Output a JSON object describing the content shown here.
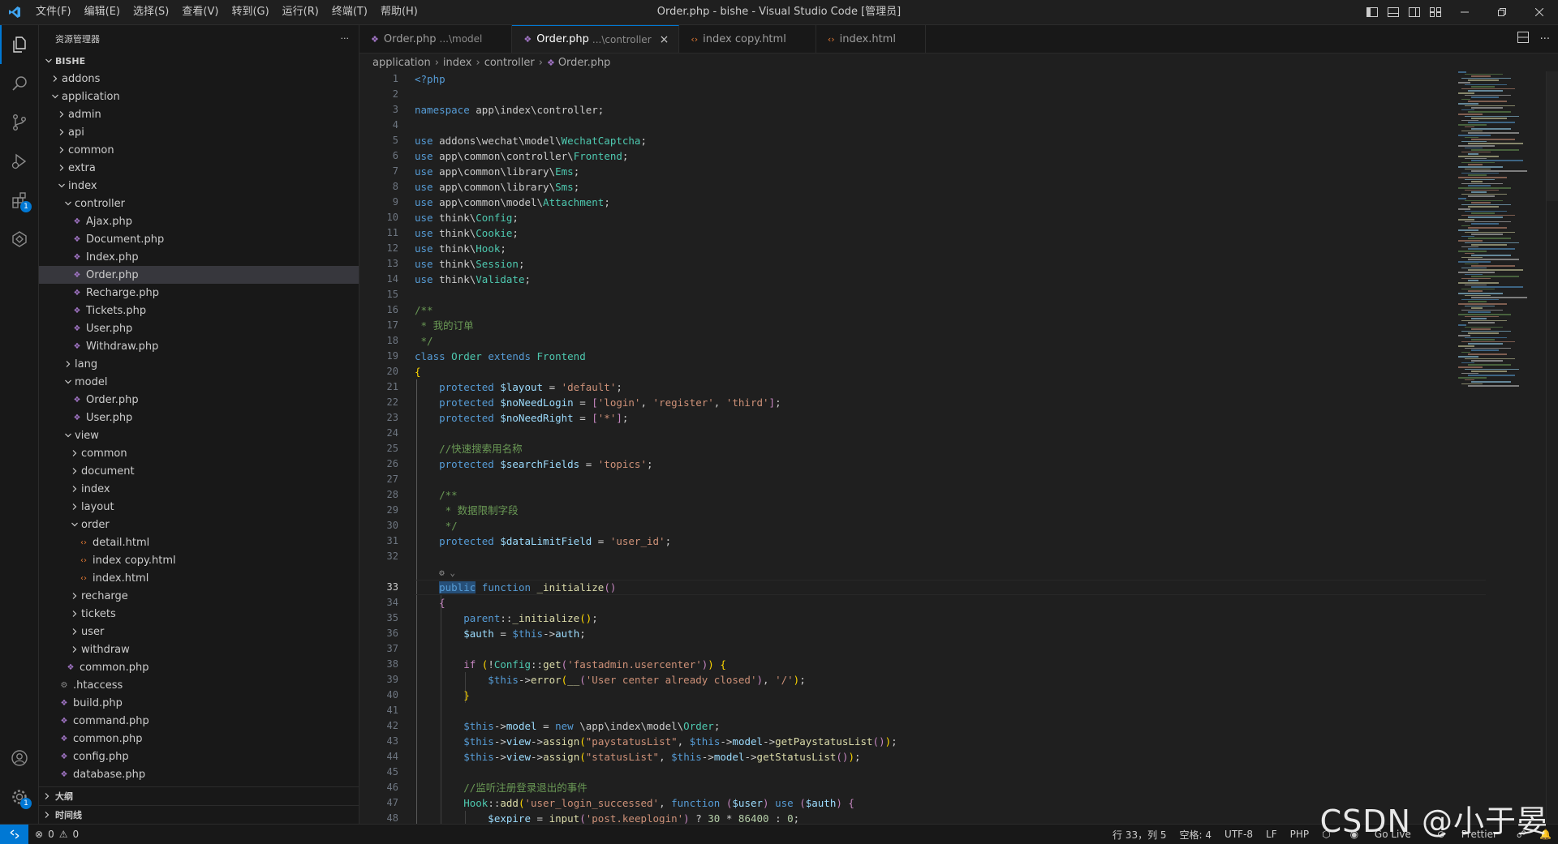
{
  "titlebar": {
    "menu": [
      "文件(F)",
      "编辑(E)",
      "选择(S)",
      "查看(V)",
      "转到(G)",
      "运行(R)",
      "终端(T)",
      "帮助(H)"
    ],
    "title": "Order.php - bishe - Visual Studio Code [管理员]"
  },
  "activity_badges": {
    "extensions": "1",
    "settings": "1"
  },
  "sidebar": {
    "title": "资源管理器",
    "more": "···",
    "bottom_sections": [
      "大纲",
      "时间线"
    ]
  },
  "tree": [
    {
      "label": "BISHE",
      "depth": 0,
      "kind": "root",
      "chev": "down"
    },
    {
      "label": "addons",
      "depth": 1,
      "kind": "folder",
      "chev": "right"
    },
    {
      "label": "application",
      "depth": 1,
      "kind": "folder",
      "chev": "down"
    },
    {
      "label": "admin",
      "depth": 2,
      "kind": "folder",
      "chev": "right"
    },
    {
      "label": "api",
      "depth": 2,
      "kind": "folder",
      "chev": "right"
    },
    {
      "label": "common",
      "depth": 2,
      "kind": "folder",
      "chev": "right"
    },
    {
      "label": "extra",
      "depth": 2,
      "kind": "folder",
      "chev": "right"
    },
    {
      "label": "index",
      "depth": 2,
      "kind": "folder",
      "chev": "down"
    },
    {
      "label": "controller",
      "depth": 3,
      "kind": "folder",
      "chev": "down"
    },
    {
      "label": "Ajax.php",
      "depth": 4,
      "kind": "php"
    },
    {
      "label": "Document.php",
      "depth": 4,
      "kind": "php"
    },
    {
      "label": "Index.php",
      "depth": 4,
      "kind": "php"
    },
    {
      "label": "Order.php",
      "depth": 4,
      "kind": "php",
      "selected": true
    },
    {
      "label": "Recharge.php",
      "depth": 4,
      "kind": "php"
    },
    {
      "label": "Tickets.php",
      "depth": 4,
      "kind": "php"
    },
    {
      "label": "User.php",
      "depth": 4,
      "kind": "php"
    },
    {
      "label": "Withdraw.php",
      "depth": 4,
      "kind": "php"
    },
    {
      "label": "lang",
      "depth": 3,
      "kind": "folder",
      "chev": "right"
    },
    {
      "label": "model",
      "depth": 3,
      "kind": "folder",
      "chev": "down"
    },
    {
      "label": "Order.php",
      "depth": 4,
      "kind": "php"
    },
    {
      "label": "User.php",
      "depth": 4,
      "kind": "php"
    },
    {
      "label": "view",
      "depth": 3,
      "kind": "folder",
      "chev": "down"
    },
    {
      "label": "common",
      "depth": 4,
      "kind": "folder",
      "chev": "right"
    },
    {
      "label": "document",
      "depth": 4,
      "kind": "folder",
      "chev": "right"
    },
    {
      "label": "index",
      "depth": 4,
      "kind": "folder",
      "chev": "right"
    },
    {
      "label": "layout",
      "depth": 4,
      "kind": "folder",
      "chev": "right"
    },
    {
      "label": "order",
      "depth": 4,
      "kind": "folder",
      "chev": "down"
    },
    {
      "label": "detail.html",
      "depth": 5,
      "kind": "html"
    },
    {
      "label": "index copy.html",
      "depth": 5,
      "kind": "html"
    },
    {
      "label": "index.html",
      "depth": 5,
      "kind": "html"
    },
    {
      "label": "recharge",
      "depth": 4,
      "kind": "folder",
      "chev": "right"
    },
    {
      "label": "tickets",
      "depth": 4,
      "kind": "folder",
      "chev": "right"
    },
    {
      "label": "user",
      "depth": 4,
      "kind": "folder",
      "chev": "right"
    },
    {
      "label": "withdraw",
      "depth": 4,
      "kind": "folder",
      "chev": "right"
    },
    {
      "label": "common.php",
      "depth": 3,
      "kind": "php"
    },
    {
      "label": ".htaccess",
      "depth": 2,
      "kind": "gear"
    },
    {
      "label": "build.php",
      "depth": 2,
      "kind": "php"
    },
    {
      "label": "command.php",
      "depth": 2,
      "kind": "php"
    },
    {
      "label": "common.php",
      "depth": 2,
      "kind": "php"
    },
    {
      "label": "config.php",
      "depth": 2,
      "kind": "php"
    },
    {
      "label": "database.php",
      "depth": 2,
      "kind": "php"
    }
  ],
  "tabs": [
    {
      "name": "Order.php",
      "desc": "...\\model",
      "kind": "php",
      "active": false
    },
    {
      "name": "Order.php",
      "desc": "...\\controller",
      "kind": "php",
      "active": true,
      "close": "×"
    },
    {
      "name": "index copy.html",
      "desc": "",
      "kind": "html",
      "active": false
    },
    {
      "name": "index.html",
      "desc": "",
      "kind": "html",
      "active": false
    }
  ],
  "breadcrumb": [
    "application",
    "index",
    "controller",
    "Order.php"
  ],
  "editor": {
    "current_line": 33,
    "line_numbers": [
      1,
      2,
      3,
      4,
      5,
      6,
      7,
      8,
      9,
      10,
      11,
      12,
      13,
      14,
      15,
      16,
      17,
      18,
      19,
      20,
      21,
      22,
      23,
      24,
      25,
      26,
      27,
      28,
      29,
      30,
      31,
      32,
      "",
      33,
      34,
      35,
      36,
      37,
      38,
      39,
      40,
      41,
      42,
      43,
      44,
      45,
      46,
      47,
      48
    ],
    "lines": [
      [
        [
          "<?php",
          "p"
        ]
      ],
      [],
      [
        [
          "namespace ",
          "k"
        ],
        [
          "app\\index\\controller",
          ""
        ],
        [
          ";",
          ""
        ]
      ],
      [],
      [
        [
          "use ",
          "k"
        ],
        [
          "addons\\wechat\\model\\",
          ""
        ],
        [
          "WechatCaptcha",
          "t"
        ],
        [
          ";",
          ""
        ]
      ],
      [
        [
          "use ",
          "k"
        ],
        [
          "app\\common\\controller\\",
          ""
        ],
        [
          "Frontend",
          "t"
        ],
        [
          ";",
          ""
        ]
      ],
      [
        [
          "use ",
          "k"
        ],
        [
          "app\\common\\library\\",
          ""
        ],
        [
          "Ems",
          "t"
        ],
        [
          ";",
          ""
        ]
      ],
      [
        [
          "use ",
          "k"
        ],
        [
          "app\\common\\library\\",
          ""
        ],
        [
          "Sms",
          "t"
        ],
        [
          ";",
          ""
        ]
      ],
      [
        [
          "use ",
          "k"
        ],
        [
          "app\\common\\model\\",
          ""
        ],
        [
          "Attachment",
          "t"
        ],
        [
          ";",
          ""
        ]
      ],
      [
        [
          "use ",
          "k"
        ],
        [
          "think\\",
          ""
        ],
        [
          "Config",
          "t"
        ],
        [
          ";",
          ""
        ]
      ],
      [
        [
          "use ",
          "k"
        ],
        [
          "think\\",
          ""
        ],
        [
          "Cookie",
          "t"
        ],
        [
          ";",
          ""
        ]
      ],
      [
        [
          "use ",
          "k"
        ],
        [
          "think\\",
          ""
        ],
        [
          "Hook",
          "t"
        ],
        [
          ";",
          ""
        ]
      ],
      [
        [
          "use ",
          "k"
        ],
        [
          "think\\",
          ""
        ],
        [
          "Session",
          "t"
        ],
        [
          ";",
          ""
        ]
      ],
      [
        [
          "use ",
          "k"
        ],
        [
          "think\\",
          ""
        ],
        [
          "Validate",
          "t"
        ],
        [
          ";",
          ""
        ]
      ],
      [],
      [
        [
          "/**",
          "c"
        ]
      ],
      [
        [
          " * 我的订单",
          "c"
        ]
      ],
      [
        [
          " */",
          "c"
        ]
      ],
      [
        [
          "class ",
          "k"
        ],
        [
          "Order ",
          "t"
        ],
        [
          "extends ",
          "k"
        ],
        [
          "Frontend",
          "t"
        ]
      ],
      [
        [
          "{",
          "b"
        ]
      ],
      [
        [
          "    protected ",
          "k"
        ],
        [
          "$layout",
          "v"
        ],
        [
          " = ",
          ""
        ],
        [
          "'default'",
          "s"
        ],
        [
          ";",
          ""
        ]
      ],
      [
        [
          "    protected ",
          "k"
        ],
        [
          "$noNeedLogin",
          "v"
        ],
        [
          " = ",
          ""
        ],
        [
          "[",
          "m"
        ],
        [
          "'login'",
          "s"
        ],
        [
          ", ",
          ""
        ],
        [
          "'register'",
          "s"
        ],
        [
          ", ",
          ""
        ],
        [
          "'third'",
          "s"
        ],
        [
          "]",
          "m"
        ],
        [
          ";",
          ""
        ]
      ],
      [
        [
          "    protected ",
          "k"
        ],
        [
          "$noNeedRight",
          "v"
        ],
        [
          " = ",
          ""
        ],
        [
          "[",
          "m"
        ],
        [
          "'*'",
          "s"
        ],
        [
          "]",
          "m"
        ],
        [
          ";",
          ""
        ]
      ],
      [],
      [
        [
          "    //快速搜索用名称",
          "c"
        ]
      ],
      [
        [
          "    protected ",
          "k"
        ],
        [
          "$searchFields",
          "v"
        ],
        [
          " = ",
          ""
        ],
        [
          "'topics'",
          "s"
        ],
        [
          ";",
          ""
        ]
      ],
      [],
      [
        [
          "    /**",
          "c"
        ]
      ],
      [
        [
          "     * 数据限制字段",
          "c"
        ]
      ],
      [
        [
          "     */",
          "c"
        ]
      ],
      [
        [
          "    protected ",
          "k"
        ],
        [
          "$dataLimitField",
          "v"
        ],
        [
          " = ",
          ""
        ],
        [
          "'user_id'",
          "s"
        ],
        [
          ";",
          ""
        ]
      ],
      [],
      [
        [
          "    ",
          ""
        ],
        [
          "⚙ ⌄",
          "lens"
        ]
      ],
      [
        [
          "    ",
          ""
        ],
        [
          "public",
          "kh"
        ],
        [
          " function ",
          "k"
        ],
        [
          "_initialize",
          "f"
        ],
        [
          "()",
          "m"
        ]
      ],
      [
        [
          "    {",
          "m"
        ]
      ],
      [
        [
          "        parent",
          "k"
        ],
        [
          "::",
          ""
        ],
        [
          "_initialize",
          "f"
        ],
        [
          "()",
          "b"
        ],
        [
          ";",
          ""
        ]
      ],
      [
        [
          "        $auth",
          "v"
        ],
        [
          " = ",
          ""
        ],
        [
          "$this",
          "k"
        ],
        [
          "->",
          ""
        ],
        [
          "auth",
          "v"
        ],
        [
          ";",
          ""
        ]
      ],
      [],
      [
        [
          "        if ",
          "m"
        ],
        [
          "(",
          "b"
        ],
        [
          "!",
          ""
        ],
        [
          "Config",
          "t"
        ],
        [
          "::",
          ""
        ],
        [
          "get",
          "f"
        ],
        [
          "(",
          "m"
        ],
        [
          "'fastadmin.usercenter'",
          "s"
        ],
        [
          ")",
          "m"
        ],
        [
          ")",
          "b"
        ],
        [
          " {",
          "b"
        ]
      ],
      [
        [
          "            $this",
          "k"
        ],
        [
          "->",
          ""
        ],
        [
          "error",
          "f"
        ],
        [
          "(",
          "b"
        ],
        [
          "__",
          "f"
        ],
        [
          "(",
          "m"
        ],
        [
          "'User center already closed'",
          "s"
        ],
        [
          ")",
          "m"
        ],
        [
          ", ",
          ""
        ],
        [
          "'/'",
          "s"
        ],
        [
          ")",
          "b"
        ],
        [
          ";",
          ""
        ]
      ],
      [
        [
          "        }",
          "b"
        ]
      ],
      [],
      [
        [
          "        $this",
          "k"
        ],
        [
          "->",
          ""
        ],
        [
          "model",
          "v"
        ],
        [
          " = ",
          ""
        ],
        [
          "new ",
          "k"
        ],
        [
          "\\app\\index\\model\\",
          ""
        ],
        [
          "Order",
          "t"
        ],
        [
          ";",
          ""
        ]
      ],
      [
        [
          "        $this",
          "k"
        ],
        [
          "->",
          ""
        ],
        [
          "view",
          "v"
        ],
        [
          "->",
          ""
        ],
        [
          "assign",
          "f"
        ],
        [
          "(",
          "b"
        ],
        [
          "\"paystatusList\"",
          "s"
        ],
        [
          ", ",
          ""
        ],
        [
          "$this",
          "k"
        ],
        [
          "->",
          ""
        ],
        [
          "model",
          "v"
        ],
        [
          "->",
          ""
        ],
        [
          "getPaystatusList",
          "f"
        ],
        [
          "()",
          "m"
        ],
        [
          ")",
          "b"
        ],
        [
          ";",
          ""
        ]
      ],
      [
        [
          "        $this",
          "k"
        ],
        [
          "->",
          ""
        ],
        [
          "view",
          "v"
        ],
        [
          "->",
          ""
        ],
        [
          "assign",
          "f"
        ],
        [
          "(",
          "b"
        ],
        [
          "\"statusList\"",
          "s"
        ],
        [
          ", ",
          ""
        ],
        [
          "$this",
          "k"
        ],
        [
          "->",
          ""
        ],
        [
          "model",
          "v"
        ],
        [
          "->",
          ""
        ],
        [
          "getStatusList",
          "f"
        ],
        [
          "()",
          "m"
        ],
        [
          ")",
          "b"
        ],
        [
          ";",
          ""
        ]
      ],
      [],
      [
        [
          "        //监听注册登录退出的事件",
          "c"
        ]
      ],
      [
        [
          "        Hook",
          "t"
        ],
        [
          "::",
          ""
        ],
        [
          "add",
          "f"
        ],
        [
          "(",
          "b"
        ],
        [
          "'user_login_successed'",
          "s"
        ],
        [
          ", ",
          ""
        ],
        [
          "function ",
          "k"
        ],
        [
          "(",
          "m"
        ],
        [
          "$user",
          "v"
        ],
        [
          ")",
          "m"
        ],
        [
          " use ",
          "k"
        ],
        [
          "(",
          "m"
        ],
        [
          "$auth",
          "v"
        ],
        [
          ")",
          "m"
        ],
        [
          " {",
          "m"
        ]
      ],
      [
        [
          "            $expire",
          "v"
        ],
        [
          " = ",
          ""
        ],
        [
          "input",
          "f"
        ],
        [
          "(",
          "m"
        ],
        [
          "'post.keeplogin'",
          "s"
        ],
        [
          ")",
          "m"
        ],
        [
          " ? ",
          ""
        ],
        [
          "30",
          "n"
        ],
        [
          " * ",
          ""
        ],
        [
          "86400",
          "n"
        ],
        [
          " : ",
          ""
        ],
        [
          "0",
          "n"
        ],
        [
          ";",
          ""
        ]
      ]
    ]
  },
  "statusbar": {
    "errors": "0",
    "warnings": "0",
    "position": "行 33，列 5",
    "spaces": "空格: 4",
    "encoding": "UTF-8",
    "eol": "LF",
    "language": "PHP",
    "golive": "Go Live",
    "prettier": "Prettier"
  },
  "watermark": "CSDN @小于晏",
  "colors": {
    "accent": "#0078d4",
    "php_icon": "#a074c4",
    "html_icon": "#e37933"
  }
}
